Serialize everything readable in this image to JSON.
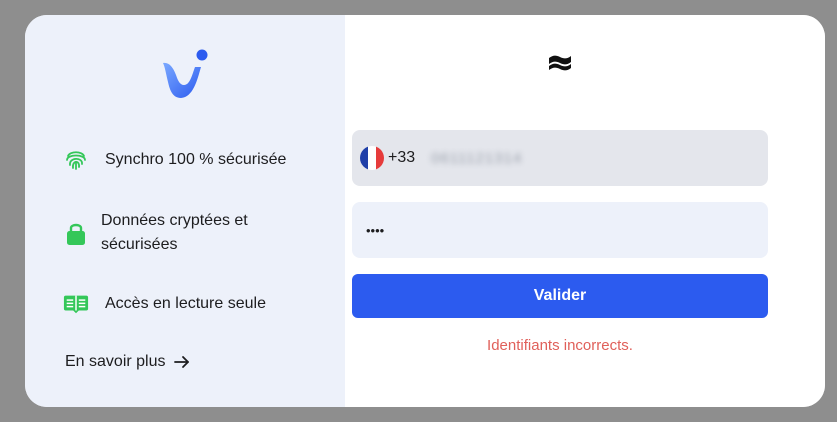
{
  "features": [
    {
      "icon": "fingerprint-icon",
      "label": "Synchro 100 % sécurisée"
    },
    {
      "icon": "lock-icon",
      "label_line1": "Données cryptées et",
      "label_line2": "sécurisées"
    },
    {
      "icon": "open-book-icon",
      "label": "Accès en lecture seule"
    }
  ],
  "learn_more": {
    "label": "En savoir plus",
    "icon": "arrow-right-icon"
  },
  "phone": {
    "country_flag": "france-flag-icon",
    "prefix": "+33",
    "value": "0611121314"
  },
  "password": {
    "value": "••••"
  },
  "submit_label": "Valider",
  "error_message": "Identifiants incorrects.",
  "colors": {
    "accent": "#2c5bef",
    "error": "#e0605a",
    "feature_icon": "#34c759",
    "left_panel": "#edf1fa"
  }
}
